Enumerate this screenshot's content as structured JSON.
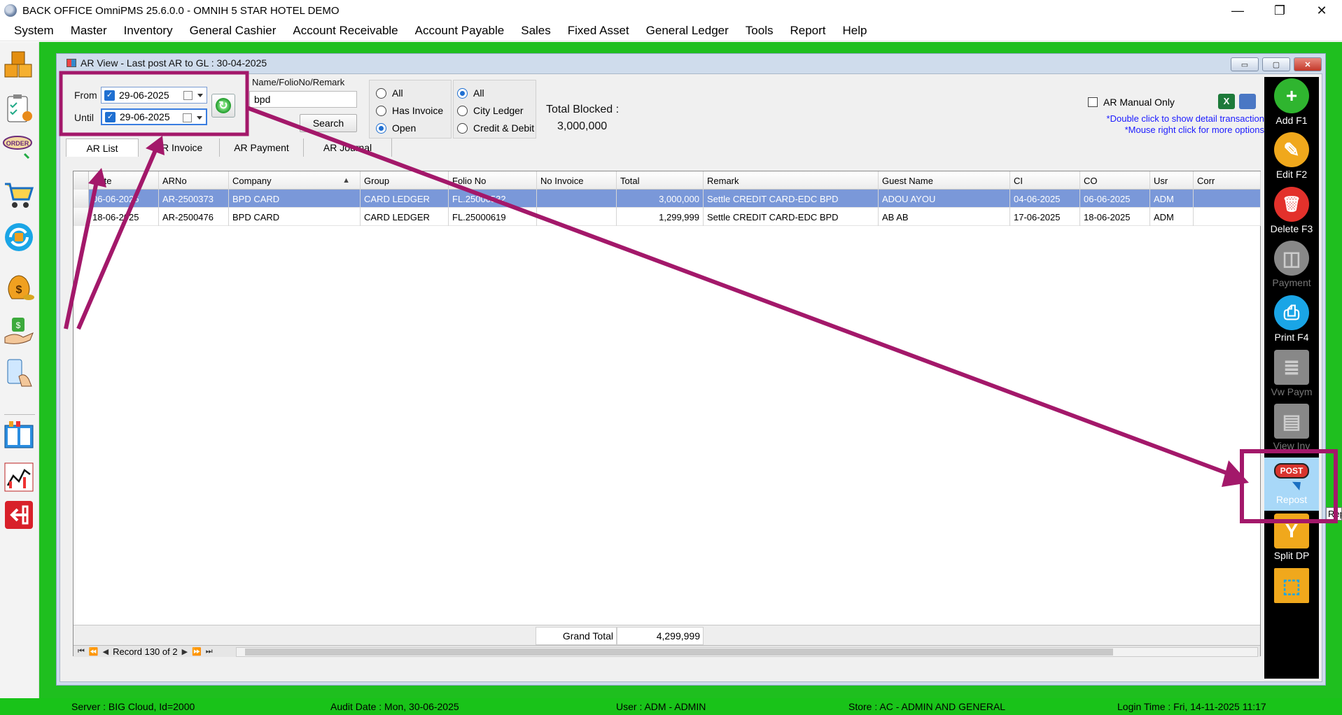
{
  "window": {
    "title": "BACK OFFICE OmniPMS 25.6.0.0 - OMNIH 5 STAR HOTEL DEMO",
    "minimize_glyph": "—",
    "restore_glyph": "❐",
    "close_glyph": "✕"
  },
  "menu": [
    "System",
    "Master",
    "Inventory",
    "General Cashier",
    "Account Receivable",
    "Account Payable",
    "Sales",
    "Fixed Asset",
    "General Ledger",
    "Tools",
    "Report",
    "Help"
  ],
  "left_toolbar_icons": [
    "inventory-boxes-icon",
    "clipboard-icon",
    "order-icon",
    "shopping-cart-icon",
    "sync-icon",
    "money-bag-icon",
    "hand-money-icon",
    "mobile-touch-icon",
    "ledger-book-icon",
    "chart-icon",
    "exit-icon"
  ],
  "ar_window": {
    "title": "AR View - Last post AR to GL : 30-04-2025",
    "mdi_min": "▭",
    "mdi_max": "▢",
    "mdi_close": "✕"
  },
  "filters": {
    "from_label": "From",
    "from_value": "29-06-2025",
    "until_label": "Until",
    "until_value": "29-06-2025",
    "search_label": "Name/FolioNo/Remark",
    "search_value": "bpd",
    "search_button": "Search",
    "invoice_filter": [
      {
        "label": "All",
        "selected": false
      },
      {
        "label": "Has Invoice",
        "selected": false
      },
      {
        "label": "Open",
        "selected": true
      }
    ],
    "ledger_filter": [
      {
        "label": "All",
        "selected": true
      },
      {
        "label": "City Ledger",
        "selected": false
      },
      {
        "label": "Credit & Debit",
        "selected": false
      }
    ],
    "total_blocked_label": "Total Blocked :",
    "total_blocked_value": "3,000,000",
    "ar_manual_only": "AR Manual Only",
    "hint1": "*Double click to show detail transaction",
    "hint2": "*Mouse right click for more options"
  },
  "tabs": [
    "AR List",
    "AR Invoice",
    "AR Payment",
    "AR Journal"
  ],
  "table": {
    "columns": [
      "Date",
      "ARNo",
      "Company",
      "Group",
      "Folio No",
      "No Invoice",
      "Total",
      "Remark",
      "Guest Name",
      "CI",
      "CO",
      "Usr",
      "Corr"
    ],
    "sort_indicator": "▲",
    "rows": [
      [
        "06-06-2025",
        "AR-2500373",
        "BPD CARD",
        "CARD LEDGER",
        "FL.25000532",
        "",
        "3,000,000",
        "Settle CREDIT CARD-EDC BPD",
        "ADOU AYOU",
        "04-06-2025",
        "06-06-2025",
        "ADM",
        ""
      ],
      [
        "18-06-2025",
        "AR-2500476",
        "BPD CARD",
        "CARD LEDGER",
        "FL.25000619",
        "",
        "1,299,999",
        "Settle CREDIT CARD-EDC BPD",
        "AB AB",
        "17-06-2025",
        "18-06-2025",
        "ADM",
        ""
      ]
    ],
    "grand_total_label": "Grand Total",
    "grand_total_value": "4,299,999",
    "record_text": "Record 130 of 2"
  },
  "right_toolbar": [
    {
      "label": "Add F1",
      "icon": "plus-icon",
      "glyph": "+",
      "color": "#2fb52f",
      "enabled": true
    },
    {
      "label": "Edit F2",
      "icon": "edit-icon",
      "glyph": "✎",
      "color": "#f0a81c",
      "enabled": true
    },
    {
      "label": "Delete F3",
      "icon": "trash-icon",
      "glyph": "🗑",
      "color": "#e3312b",
      "enabled": true
    },
    {
      "label": "Payment",
      "icon": "payment-icon",
      "glyph": "◫",
      "color": "#888888",
      "enabled": false
    },
    {
      "label": "Print F4",
      "icon": "printer-icon",
      "glyph": "⎙",
      "color": "#1aa5e6",
      "enabled": true
    },
    {
      "label": "Vw Paym",
      "icon": "receipt-icon",
      "glyph": "≣",
      "color": "#888888",
      "enabled": false
    },
    {
      "label": "View Inv",
      "icon": "invoice-icon",
      "glyph": "▤",
      "color": "#888888",
      "enabled": false
    },
    {
      "label": "Repost",
      "icon": "post-cursor-icon",
      "glyph": "POST",
      "color": "#d8352e",
      "enabled": true
    },
    {
      "label": "Split DP",
      "icon": "filter-split-icon",
      "glyph": "Y",
      "color": "#f0a81c",
      "enabled": true
    },
    {
      "label": "",
      "icon": "select-icon",
      "glyph": "⬚",
      "color": "#1aa5e6",
      "enabled": true
    }
  ],
  "tooltip": "Repost",
  "status": {
    "server": "Server : BIG Cloud, Id=2000",
    "audit": "Audit Date : Mon, 30-06-2025",
    "user": "User : ADM - ADMIN",
    "store": "Store : AC - ADMIN AND GENERAL",
    "login": "Login Time : Fri, 14-11-2025 11:17"
  },
  "colors": {
    "desktop": "#1fbf1f",
    "annotation": "#a3186a",
    "selected_row": "#7a98d9"
  }
}
